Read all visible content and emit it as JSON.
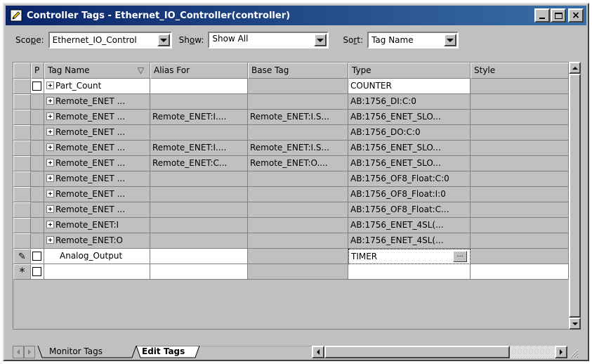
{
  "window": {
    "title": "Controller Tags - Ethernet_IO_Controller(controller)",
    "buttons": {
      "minimize": "_",
      "maximize": "□",
      "close": "×"
    }
  },
  "toolbar": {
    "scope_label_pre": "Sco",
    "scope_label_ul": "p",
    "scope_label_post": "e:",
    "scope_value": "Ethernet_IO_Control",
    "show_label_pre": "Sh",
    "show_label_ul": "o",
    "show_label_post": "w:",
    "show_value": "Show All",
    "sort_label_pre": "So",
    "sort_label_ul": "r",
    "sort_label_post": "t:",
    "sort_value": "Tag Name"
  },
  "grid": {
    "headers": {
      "p": "P",
      "tag_name": "Tag Name",
      "sort_indicator": "▽",
      "alias_for": "Alias For",
      "base_tag": "Base Tag",
      "type": "Type",
      "style": "Style"
    },
    "rows": [
      {
        "tag": "Part_Count",
        "alias": "",
        "base": "",
        "type": "COUNTER"
      },
      {
        "tag": "Remote_ENET ...",
        "alias": "",
        "base": "",
        "type": "AB:1756_DI:C:0"
      },
      {
        "tag": "Remote_ENET ...",
        "alias": "Remote_ENET:I....",
        "base": "Remote_ENET:I.S...",
        "type": "AB:1756_ENET_SLO..."
      },
      {
        "tag": "Remote_ENET ...",
        "alias": "",
        "base": "",
        "type": "AB:1756_DO:C:0"
      },
      {
        "tag": "Remote_ENET ...",
        "alias": "Remote_ENET:I....",
        "base": "Remote_ENET:I.S...",
        "type": "AB:1756_ENET_SLO..."
      },
      {
        "tag": "Remote_ENET ...",
        "alias": "Remote_ENET:C...",
        "base": "Remote_ENET:O....",
        "type": "AB:1756_ENET_SLO..."
      },
      {
        "tag": "Remote_ENET ...",
        "alias": "",
        "base": "",
        "type": "AB:1756_OF8_Float:C:0"
      },
      {
        "tag": "Remote_ENET ...",
        "alias": "",
        "base": "",
        "type": "AB:1756_OF8_Float:I:0"
      },
      {
        "tag": "Remote_ENET ...",
        "alias": "",
        "base": "",
        "type": "AB:1756_OF8_Float:C..."
      },
      {
        "tag": "Remote_ENET:I",
        "alias": "",
        "base": "",
        "type": "AB:1756_ENET_4SL(..."
      },
      {
        "tag": "Remote_ENET:O",
        "alias": "",
        "base": "",
        "type": "AB:1756_ENET_4SL(..."
      },
      {
        "tag": "Analog_Output",
        "alias": "",
        "base": "",
        "type": "TIMER"
      }
    ],
    "edit_row_marker": "✎",
    "new_row_marker": "*",
    "ellipsis": "..."
  },
  "tabs": {
    "monitor": "Monitor Tags",
    "edit": "Edit Tags"
  },
  "colors": {
    "title_start": "#0a246a",
    "title_end": "#3a6ea5",
    "face": "#c0c0c0"
  }
}
